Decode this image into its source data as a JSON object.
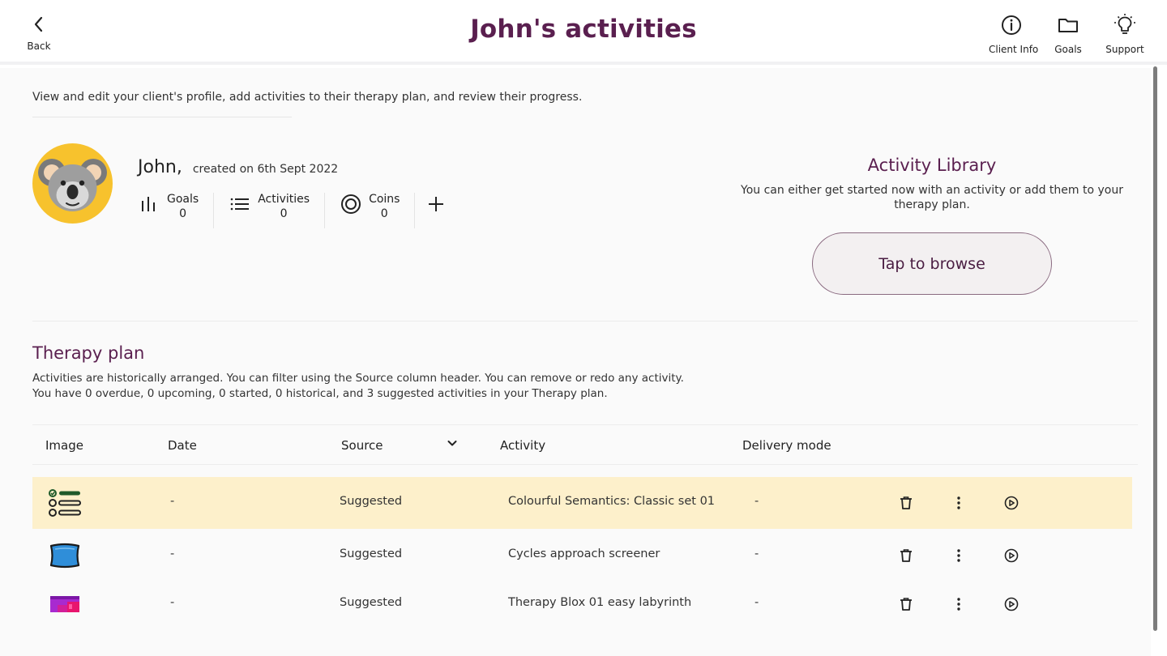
{
  "header": {
    "back_label": "Back",
    "title": "John's activities",
    "actions": [
      {
        "label": "Client Info",
        "icon": "info-icon"
      },
      {
        "label": "Goals",
        "icon": "folder-icon"
      },
      {
        "label": "Support",
        "icon": "lightbulb-icon"
      }
    ]
  },
  "intro": "View and edit your client's profile, add activities to their therapy plan, and review their progress.",
  "client": {
    "name": "John,",
    "created": "created on 6th Sept 2022",
    "avatar_icon": "koala-icon",
    "stats": [
      {
        "name": "Goals",
        "value": "0",
        "icon": "bar-chart-icon"
      },
      {
        "name": "Activities",
        "value": "0",
        "icon": "list-icon"
      },
      {
        "name": "Coins",
        "value": "0",
        "icon": "target-icon"
      }
    ]
  },
  "library": {
    "title": "Activity Library",
    "description": "You can either get started now with an activity or add them to your therapy plan.",
    "browse_label": "Tap to browse"
  },
  "plan": {
    "title": "Therapy plan",
    "desc_line1": "Activities are historically arranged. You can filter using the Source column header. You can remove or redo any activity.",
    "desc_line2": "You have 0 overdue, 0 upcoming, 0 started, 0 historical, and 3 suggested activities in your Therapy plan.",
    "columns": {
      "image": "Image",
      "date": "Date",
      "source": "Source",
      "activity": "Activity",
      "delivery": "Delivery mode"
    },
    "rows": [
      {
        "date": "-",
        "source": "Suggested",
        "activity": "Colourful Semantics: Classic set 01",
        "delivery": "-",
        "image_icon": "checklist-icon",
        "highlighted": true
      },
      {
        "date": "-",
        "source": "Suggested",
        "activity": "Cycles approach screener",
        "delivery": "-",
        "image_icon": "pillow-icon",
        "highlighted": false
      },
      {
        "date": "-",
        "source": "Suggested",
        "activity": "Therapy Blox 01 easy labyrinth",
        "delivery": "-",
        "image_icon": "labyrinth-icon",
        "highlighted": false
      }
    ]
  },
  "colors": {
    "brand": "#5a1f4f",
    "highlight_row": "#fdf0cb",
    "avatar_bg": "#f7c22d"
  }
}
